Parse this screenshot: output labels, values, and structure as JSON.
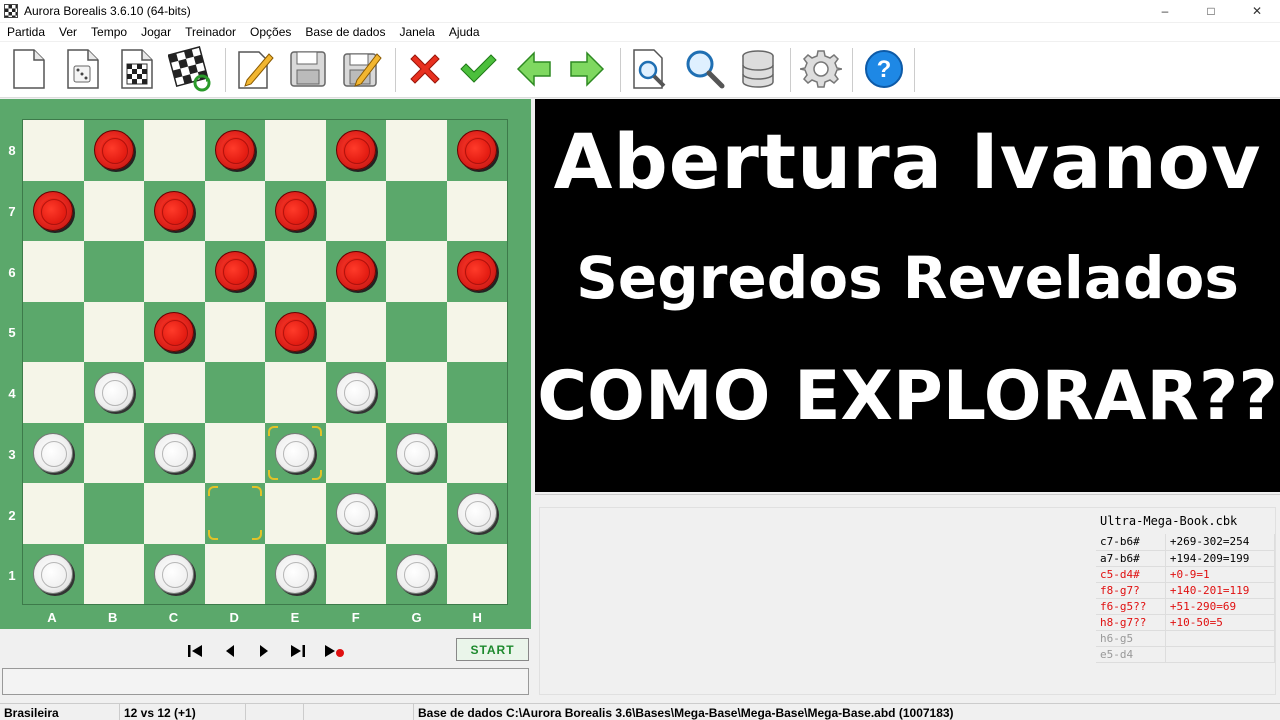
{
  "window": {
    "title": "Aurora Borealis 3.6.10 (64-bits)",
    "controls": [
      "–",
      "□",
      "✕"
    ]
  },
  "menu": [
    "Partida",
    "Ver",
    "Tempo",
    "Jogar",
    "Treinador",
    "Opções",
    "Base de dados",
    "Janela",
    "Ajuda"
  ],
  "toolbar": {
    "icons": [
      "new-document-icon",
      "random-dice-icon",
      "board-setup-icon",
      "board-rotate-icon",
      "edit-pencil-icon",
      "save-disk-icon",
      "save-as-icon",
      "reject-x-icon",
      "accept-check-icon",
      "back-arrow-icon",
      "forward-arrow-icon",
      "search-page-icon",
      "search-magnifier-icon",
      "database-icon",
      "settings-gear-icon",
      "help-question-icon"
    ]
  },
  "board": {
    "ranks": [
      "8",
      "7",
      "6",
      "5",
      "4",
      "3",
      "2",
      "1"
    ],
    "files": [
      "A",
      "B",
      "C",
      "D",
      "E",
      "F",
      "G",
      "H"
    ],
    "red_pieces": [
      "b8",
      "d8",
      "f8",
      "h8",
      "a7",
      "c7",
      "e7",
      "d6",
      "f6",
      "h6",
      "c5",
      "e5"
    ],
    "white_pieces": [
      "b4",
      "f4",
      "a3",
      "c3",
      "e3",
      "g3",
      "f2",
      "h2",
      "a1",
      "c1",
      "e1",
      "g1"
    ],
    "highlighted": [
      "e3",
      "d2"
    ],
    "colors": {
      "light": "#f5f5e8",
      "dark": "#5ba86b",
      "red": "#e0180f",
      "white": "#f5f5f5",
      "highlight": "#e2c227"
    }
  },
  "navigation": {
    "buttons": [
      "first-move-icon",
      "prev-move-icon",
      "next-move-icon",
      "last-move-icon",
      "auto-play-icon"
    ],
    "start_label": "START"
  },
  "overlay": {
    "line1": "Abertura Ivanov",
    "line2": "Segredos Revelados",
    "line3": "COMO EXPLORAR??"
  },
  "book": {
    "title": "Ultra-Mega-Book.cbk",
    "rows": [
      {
        "move": "c7-b6#",
        "score": "+269-302=254",
        "color": "black"
      },
      {
        "move": "a7-b6#",
        "score": "+194-209=199",
        "color": "black"
      },
      {
        "move": "c5-d4#",
        "score": "+0-9=1",
        "color": "red"
      },
      {
        "move": "f8-g7?",
        "score": "+140-201=119",
        "color": "red"
      },
      {
        "move": "f6-g5??",
        "score": "+51-290=69",
        "color": "red"
      },
      {
        "move": "h8-g7??",
        "score": "+10-50=5",
        "color": "red"
      },
      {
        "move": "h6-g5",
        "score": "",
        "color": "gray"
      },
      {
        "move": "e5-d4",
        "score": "",
        "color": "gray"
      }
    ]
  },
  "status": {
    "variant": "Brasileira",
    "count": "12 vs 12  (+1)",
    "database": "Base de dados C:\\Aurora Borealis 3.6\\Bases\\Mega-Base\\Mega-Base\\Mega-Base.abd (1007183)"
  }
}
